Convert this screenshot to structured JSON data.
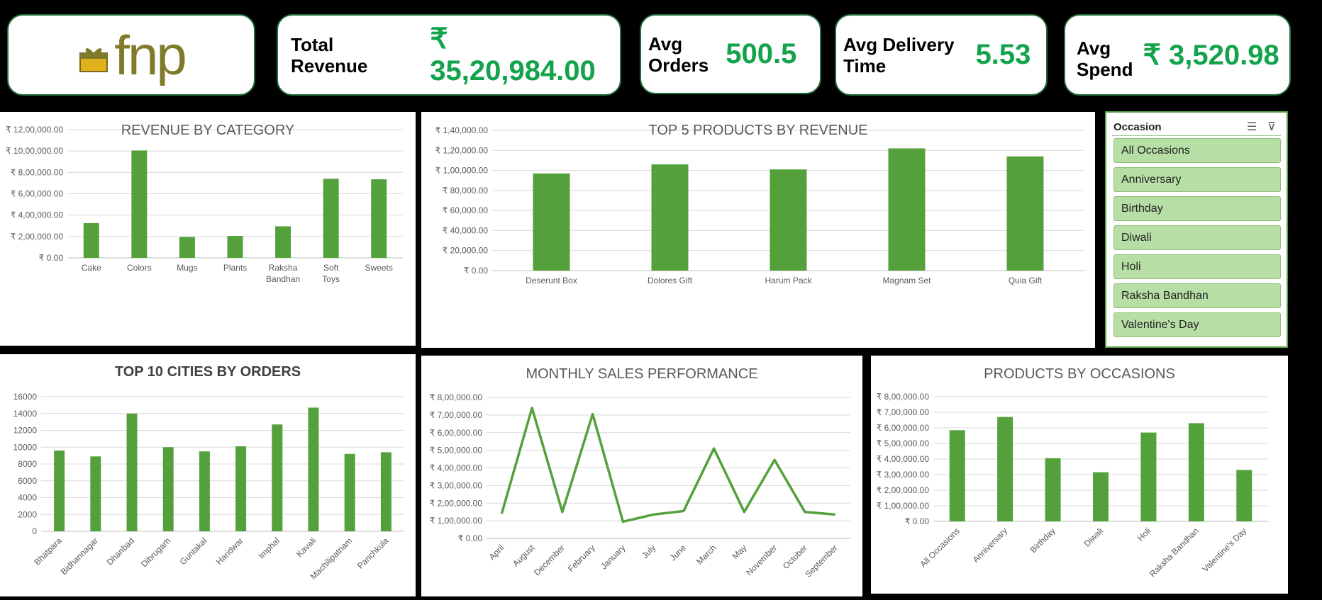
{
  "logo": {
    "text": "fnp",
    "icon": "gift-box-icon"
  },
  "kpis": {
    "total_revenue": {
      "label": "Total Revenue",
      "value": "₹ 35,20,984.00"
    },
    "avg_orders": {
      "label_line1": "Avg",
      "label_line2": "Orders",
      "value": "500.5"
    },
    "avg_delivery": {
      "label_line1": "Avg Delivery",
      "label_line2": "Time",
      "value": "5.53"
    },
    "avg_spend": {
      "label_line1": "Avg",
      "label_line2": "Spend",
      "value": "₹ 3,520.98"
    }
  },
  "colors": {
    "accent": "#12a34b",
    "bar": "#54a13c",
    "border": "#1f6f3a"
  },
  "slicer": {
    "title": "Occasion",
    "multi_select_icon": "multi-select-icon",
    "clear_filter_icon": "clear-filter-icon",
    "items": [
      "All Occasions",
      "Anniversary",
      "Birthday",
      "Diwali",
      "Holi",
      "Raksha Bandhan",
      "Valentine's Day"
    ]
  },
  "chart_data": [
    {
      "id": "revenue_by_category",
      "type": "bar",
      "title": "REVENUE BY CATEGORY",
      "categories": [
        "Cake",
        "Colors",
        "Mugs",
        "Plants",
        "Raksha Bandhan",
        "Soft Toys",
        "Sweets"
      ],
      "values": [
        325000,
        1005000,
        195000,
        205000,
        295000,
        740000,
        735000
      ],
      "ylim": [
        0,
        1200000
      ],
      "yticks": [
        "₹ 0.00",
        "₹ 2,00,000.00",
        "₹ 4,00,000.00",
        "₹ 6,00,000.00",
        "₹ 8,00,000.00",
        "₹ 10,00,000.00",
        "₹ 12,00,000.00"
      ],
      "grid": true
    },
    {
      "id": "top5_products",
      "type": "bar",
      "title": "TOP 5 PRODUCTS BY REVENUE",
      "categories": [
        "Deserunt Box",
        "Dolores Gift",
        "Harum Pack",
        "Magnam Set",
        "Quia Gift"
      ],
      "values": [
        97000,
        106000,
        101000,
        122000,
        114000
      ],
      "ylim": [
        0,
        140000
      ],
      "yticks": [
        "₹ 0.00",
        "₹ 20,000.00",
        "₹ 40,000.00",
        "₹ 60,000.00",
        "₹ 80,000.00",
        "₹ 1,00,000.00",
        "₹ 1,20,000.00",
        "₹ 1,40,000.00"
      ],
      "grid": true
    },
    {
      "id": "top10_cities",
      "type": "bar",
      "title": "TOP 10 CITIES BY ORDERS",
      "categories": [
        "Bhatpara",
        "Bidhannagar",
        "Dhanbad",
        "Dibrugarh",
        "Guntakal",
        "Haridwar",
        "Imphal",
        "Kavali",
        "Machilipatnam",
        "Panchkula"
      ],
      "values": [
        9600,
        8900,
        14000,
        10000,
        9500,
        10100,
        12700,
        14700,
        9200,
        9400
      ],
      "ylim": [
        0,
        16000
      ],
      "yticks": [
        "0",
        "2000",
        "4000",
        "6000",
        "8000",
        "10000",
        "12000",
        "14000",
        "16000"
      ],
      "grid": true
    },
    {
      "id": "monthly_sales",
      "type": "line",
      "title": "MONTHLY SALES PERFORMANCE",
      "categories": [
        "April",
        "August",
        "December",
        "February",
        "January",
        "July",
        "June",
        "March",
        "May",
        "November",
        "October",
        "September"
      ],
      "values": [
        140000,
        740000,
        150000,
        705000,
        95000,
        135000,
        155000,
        510000,
        150000,
        445000,
        150000,
        135000
      ],
      "ylim": [
        0,
        800000
      ],
      "yticks": [
        "₹ 0.00",
        "₹ 1,00,000.00",
        "₹ 2,00,000.00",
        "₹ 3,00,000.00",
        "₹ 4,00,000.00",
        "₹ 5,00,000.00",
        "₹ 6,00,000.00",
        "₹ 7,00,000.00",
        "₹ 8,00,000.00"
      ],
      "grid": true
    },
    {
      "id": "products_by_occasion",
      "type": "bar",
      "title": "PRODUCTS BY OCCASIONS",
      "categories": [
        "All Occasions",
        "Anniversary",
        "Birthday",
        "Diwali",
        "Holi",
        "Raksha Bandhan",
        "Valentine's Day"
      ],
      "values": [
        585000,
        670000,
        405000,
        315000,
        570000,
        630000,
        330000
      ],
      "ylim": [
        0,
        800000
      ],
      "yticks": [
        "₹ 0.00",
        "₹ 1,00,000.00",
        "₹ 2,00,000.00",
        "₹ 3,00,000.00",
        "₹ 4,00,000.00",
        "₹ 5,00,000.00",
        "₹ 6,00,000.00",
        "₹ 7,00,000.00",
        "₹ 8,00,000.00"
      ],
      "grid": true
    }
  ]
}
